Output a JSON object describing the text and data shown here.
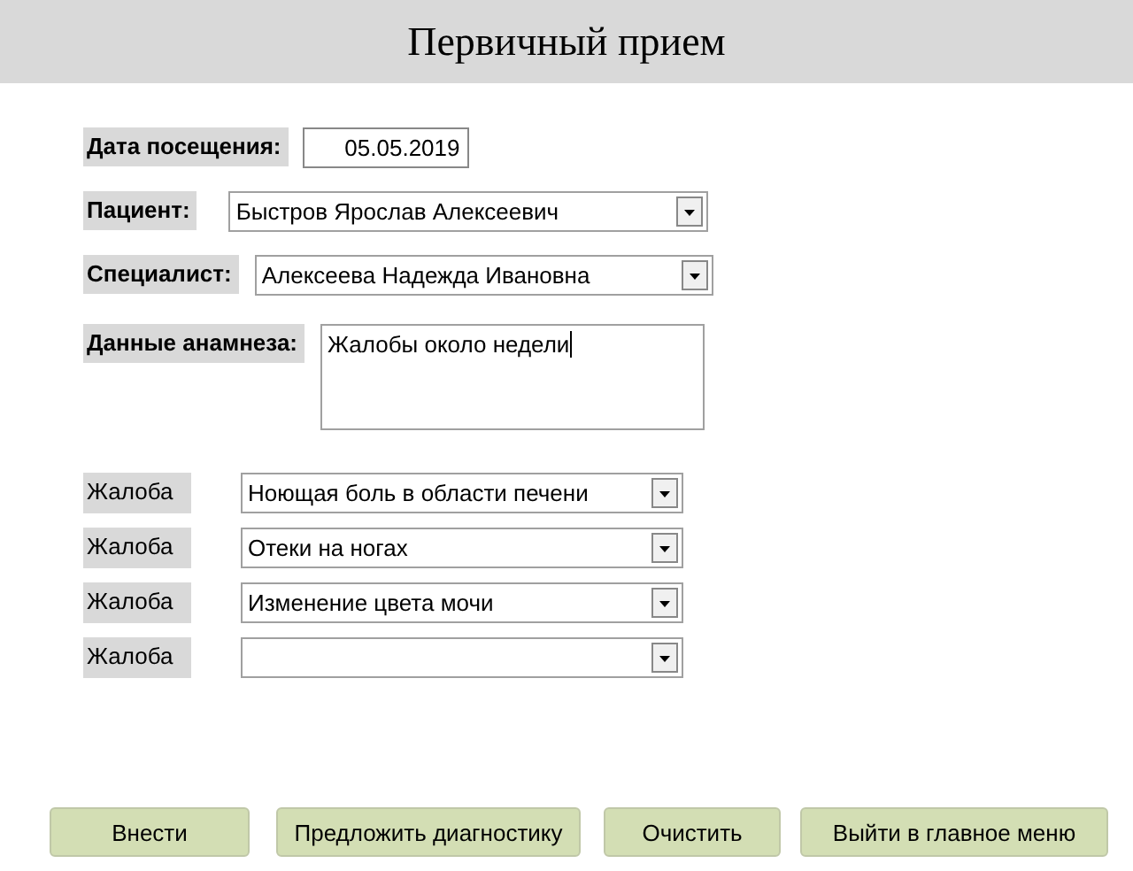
{
  "window": {
    "title": "Первичный прием"
  },
  "fields": [
    {
      "kind": "date",
      "label": "Дата посещения:",
      "value": "05.05.2019"
    },
    {
      "kind": "combo",
      "label": "Пациент:",
      "value": "Быстров Ярослав Алексеевич"
    },
    {
      "kind": "combo",
      "label": "Специалист:",
      "value": "Алексеева Надежда Ивановна"
    },
    {
      "kind": "memo",
      "label": "Данные анамнеза:",
      "value": "Жалобы около недели"
    }
  ],
  "complaints": [
    {
      "label": "Жалоба",
      "value": "Ноющая боль в области печени"
    },
    {
      "label": "Жалоба",
      "value": "Отеки на ногах"
    },
    {
      "label": "Жалоба",
      "value": "Изменение цвета мочи"
    },
    {
      "label": "Жалоба"
    }
  ],
  "buttons": [
    "Внести",
    "Предложить диагностику",
    "Очистить",
    "Выйти в главное меню"
  ]
}
